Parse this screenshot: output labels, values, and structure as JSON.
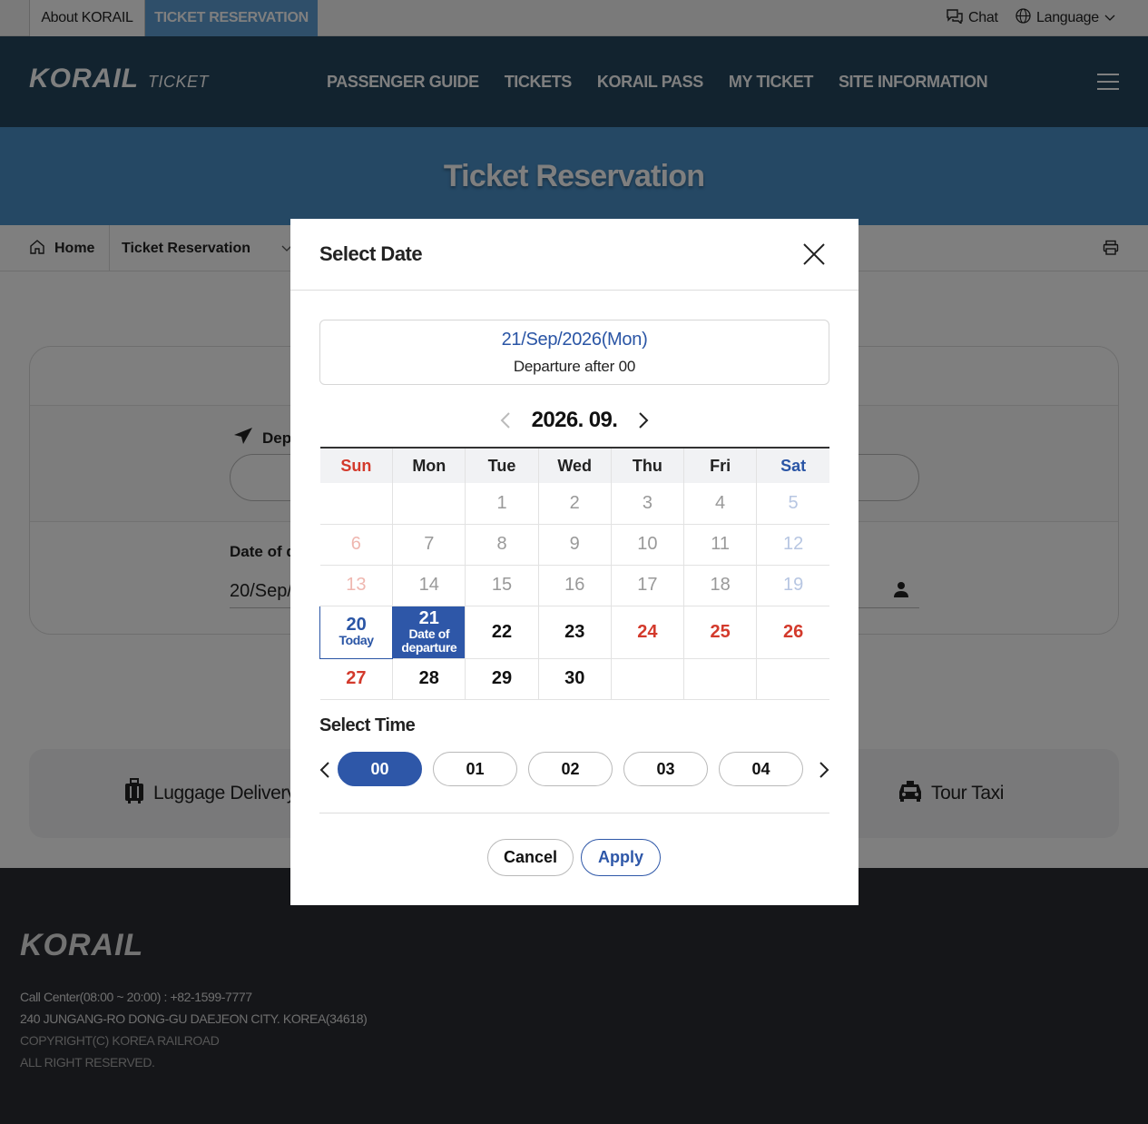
{
  "topbar": {
    "about": "About KORAIL",
    "reservation": "TICKET RESERVATION",
    "chat": "Chat",
    "language": "Language"
  },
  "header": {
    "logo_brand": "KORAIL",
    "logo_sub": "TICKET",
    "nav": [
      "PASSENGER GUIDE",
      "TICKETS",
      "KORAIL PASS",
      "MY TICKET",
      "SITE INFORMATION"
    ]
  },
  "banner": {
    "title": "Ticket Reservation"
  },
  "breadcrumb": {
    "home": "Home",
    "current": "Ticket Reservation"
  },
  "form": {
    "departure_label": "Dep",
    "date_label": "Date of d",
    "date_value": "20/Sep/"
  },
  "services": {
    "luggage": "Luggage Delivery",
    "taxi": "Tour Taxi"
  },
  "footer": {
    "logo": "KORAIL",
    "call_center": "Call Center(08:00 ~ 20:00) : +82-1599-7777",
    "address": "240 JUNGANG-RO DONG-GU DAEJEON CITY. KOREA(34618)",
    "copyright": "COPYRIGHT(C) KOREA RAILROAD",
    "rights": "ALL RIGHT RESERVED."
  },
  "modal": {
    "title": "Select Date",
    "summary_date": "21/Sep/2026(Mon)",
    "summary_time": "Departure after 00",
    "month": "2026. 09.",
    "weekdays": [
      "Sun",
      "Mon",
      "Tue",
      "Wed",
      "Thu",
      "Fri",
      "Sat"
    ],
    "weeks": [
      [
        "",
        "",
        "1",
        "2",
        "3",
        "4",
        "5"
      ],
      [
        "6",
        "7",
        "8",
        "9",
        "10",
        "11",
        "12"
      ],
      [
        "13",
        "14",
        "15",
        "16",
        "17",
        "18",
        "19"
      ],
      [
        "20",
        "21",
        "22",
        "23",
        "24",
        "25",
        "26"
      ],
      [
        "27",
        "28",
        "29",
        "30",
        "",
        "",
        ""
      ]
    ],
    "today_label": "Today",
    "departure_label": "Date of departure",
    "time_title": "Select Time",
    "times": [
      "00",
      "01",
      "02",
      "03",
      "04"
    ],
    "selected_time": "00",
    "cancel": "Cancel",
    "apply": "Apply"
  },
  "colors": {
    "header": "#24465f",
    "banner": "#4a90c8",
    "accent_blue": "#2e57a8",
    "sunday_red": "#d33a2c",
    "footer": "#2a2d33"
  }
}
